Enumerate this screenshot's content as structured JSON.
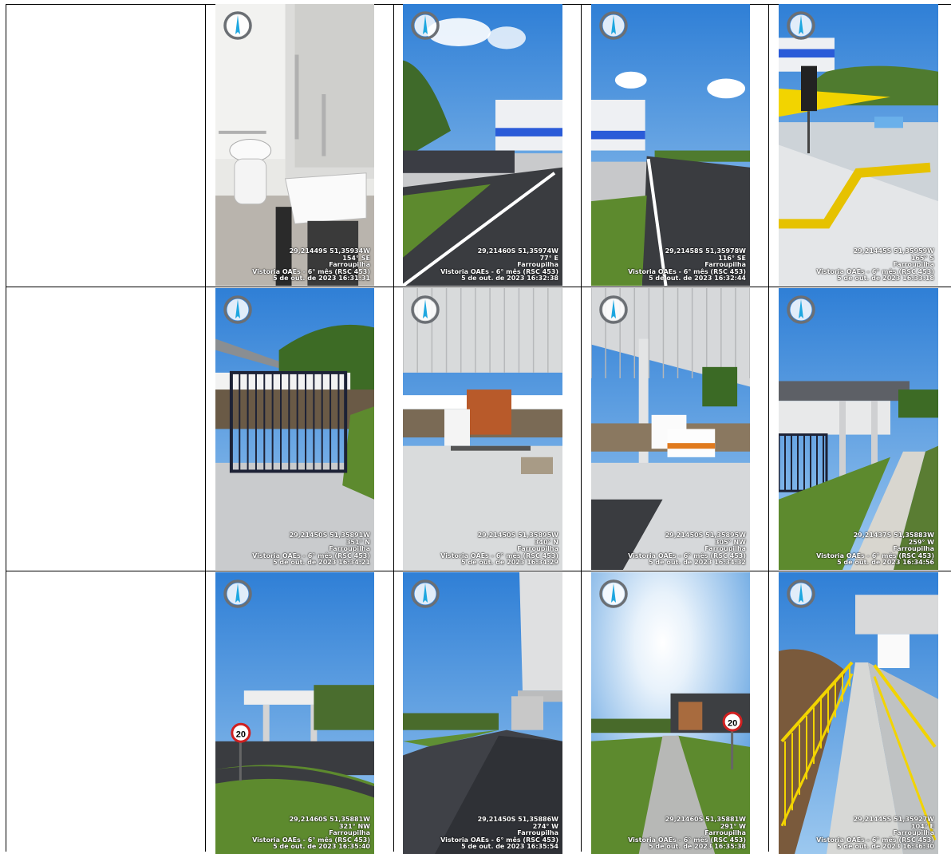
{
  "document": {
    "photos": [
      {
        "scene": "bathroom",
        "coords": "29,21449S 51,35934W",
        "heading": "154° SE",
        "city": "Farroupilha",
        "project": "Vistoria OAEs - 6° mês (RSC 453)",
        "datetime": "5 de out. de 2023 16:31:31"
      },
      {
        "scene": "road-left",
        "coords": "29,21460S 51,35974W",
        "heading": "77° E",
        "city": "Farroupilha",
        "project": "Vistoria OAEs - 6° mês (RSC 453)",
        "datetime": "5 de out. de 2023 16:32:38"
      },
      {
        "scene": "road-right",
        "coords": "29,21458S 51,35978W",
        "heading": "116° SE",
        "city": "Farroupilha",
        "project": "Vistoria OAEs - 6° mês (RSC 453)",
        "datetime": "5 de out. de 2023 16:32:44"
      },
      {
        "scene": "tactile",
        "coords": "29,21445S 51,35959W",
        "heading": "165° S",
        "city": "Farroupilha",
        "project": "Vistoria OAEs - 6° mês (RSC 453)",
        "datetime": "5 de out. de 2023 16:33:18"
      },
      {
        "scene": "cage",
        "coords": "29,21450S 51,35891W",
        "heading": "351° N",
        "city": "Farroupilha",
        "project": "Vistoria OAEs - 6° mês (RSC 453)",
        "datetime": "5 de out. de 2023 16:34:21"
      },
      {
        "scene": "canopy-trailer",
        "coords": "29,21450S 51,35895W",
        "heading": "340° N",
        "city": "Farroupilha",
        "project": "Vistoria OAEs - 6° mês (RSC 453)",
        "datetime": "5 de out. de 2023 16:34:29"
      },
      {
        "scene": "canopy-ambulance",
        "coords": "29,21450S 51,35895W",
        "heading": "305° NW",
        "city": "Farroupilha",
        "project": "Vistoria OAEs - 6° mês (RSC 453)",
        "datetime": "5 de out. de 2023 16:34:32"
      },
      {
        "scene": "building-ditch",
        "coords": "29,21437S 51,35883W",
        "heading": "259° W",
        "city": "Farroupilha",
        "project": "Vistoria OAEs - 6° mês (RSC 453)",
        "datetime": "5 de out. de 2023 16:34:56"
      },
      {
        "scene": "canopy-sign",
        "coords": "29,21460S 51,35881W",
        "heading": "321° NW",
        "city": "Farroupilha",
        "project": "Vistoria OAEs - 6° mês (RSC 453)",
        "datetime": "5 de out. de 2023 16:35:40"
      },
      {
        "scene": "road-canopy",
        "coords": "29,21450S 51,35886W",
        "heading": "274° W",
        "city": "Farroupilha",
        "project": "Vistoria OAEs - 6° mês (RSC 453)",
        "datetime": "5 de out. de 2023 16:35:54"
      },
      {
        "scene": "sun-path",
        "coords": "29,21460S 51,35881W",
        "heading": "291° W",
        "city": "Farroupilha",
        "project": "Vistoria OAEs - 6° mês (RSC 453)",
        "datetime": "5 de out. de 2023 16:35:38"
      },
      {
        "scene": "walkway",
        "coords": "29,21445S 51,35927W",
        "heading": "104° E",
        "city": "Farroupilha",
        "project": "Vistoria OAEs - 6° mês (RSC 453)",
        "datetime": "5 de out. de 2023 16:36:30"
      }
    ]
  },
  "colors": {
    "sky": "#3f8fe0",
    "grass": "#5d8a2e",
    "asphalt": "#3a3c40",
    "concrete": "#cfd2d4",
    "tactile": "#e6c200",
    "railing": "#f2d400",
    "compass_needle": "#1ea7e0"
  },
  "icons": [
    "compass-icon"
  ]
}
